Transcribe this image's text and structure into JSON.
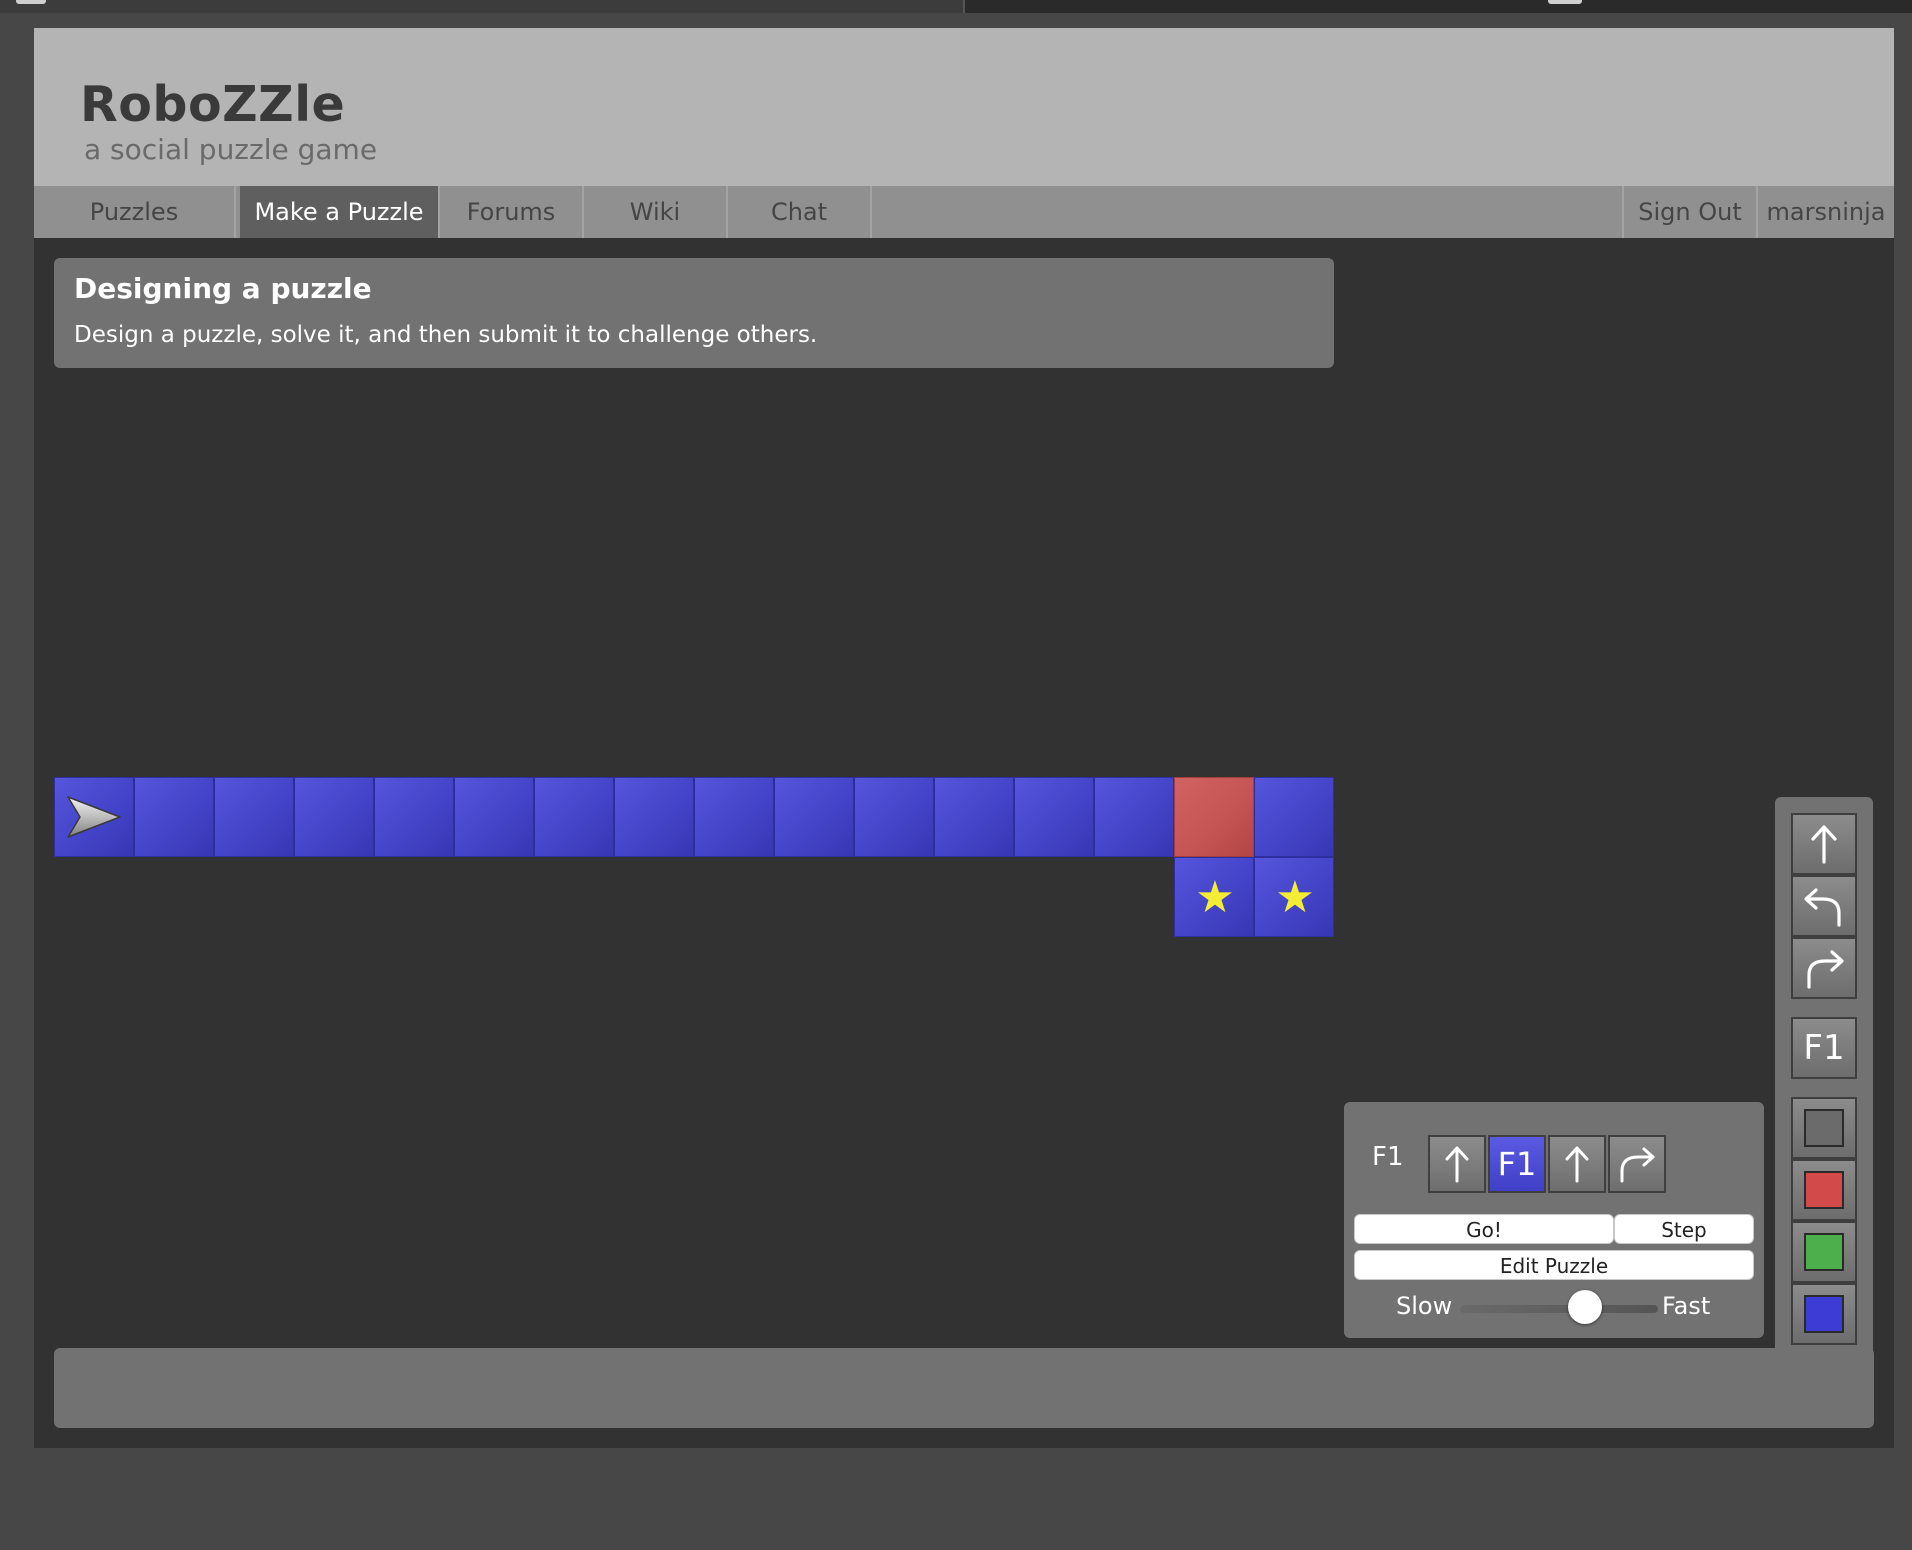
{
  "app": {
    "title": "RoboZZle",
    "tagline": "a social puzzle game"
  },
  "nav": {
    "tabs": [
      {
        "label": "Puzzles",
        "active": false
      },
      {
        "label": "Make a Puzzle",
        "active": true
      },
      {
        "label": "Forums",
        "active": false
      },
      {
        "label": "Wiki",
        "active": false
      },
      {
        "label": "Chat",
        "active": false
      }
    ],
    "sign_out": "Sign Out",
    "username": "marsninja"
  },
  "info": {
    "heading": "Designing a puzzle",
    "description": "Design a puzzle, solve it, and then submit it to challenge others."
  },
  "board": {
    "row1": [
      "blue",
      "blue",
      "blue",
      "blue",
      "blue",
      "blue",
      "blue",
      "blue",
      "blue",
      "blue",
      "blue",
      "blue",
      "blue",
      "blue",
      "red",
      "blue"
    ],
    "row2": [
      {
        "col": 14,
        "color": "blue",
        "star": true
      },
      {
        "col": 15,
        "color": "blue",
        "star": true
      }
    ],
    "robot": {
      "row": 0,
      "col": 0,
      "facing": "right"
    },
    "star_glyph": "★"
  },
  "program": {
    "label": "F1",
    "slots": [
      {
        "type": "forward",
        "icon": "forward-arrow-icon",
        "color": "none"
      },
      {
        "type": "call",
        "label": "F1",
        "color": "blue"
      },
      {
        "type": "forward",
        "icon": "forward-arrow-icon",
        "color": "none"
      },
      {
        "type": "turn-right",
        "icon": "turn-right-icon",
        "color": "none"
      }
    ],
    "go_label": "Go!",
    "step_label": "Step",
    "edit_label": "Edit Puzzle",
    "slow_label": "Slow",
    "fast_label": "Fast",
    "speed_fraction": 0.63
  },
  "palette": {
    "commands": [
      "forward-arrow-icon",
      "turn-left-icon",
      "turn-right-icon"
    ],
    "function_label": "F1",
    "colors": [
      "#6b6b6b",
      "#d34a4a",
      "#4caf4c",
      "#3d3dd6"
    ]
  }
}
